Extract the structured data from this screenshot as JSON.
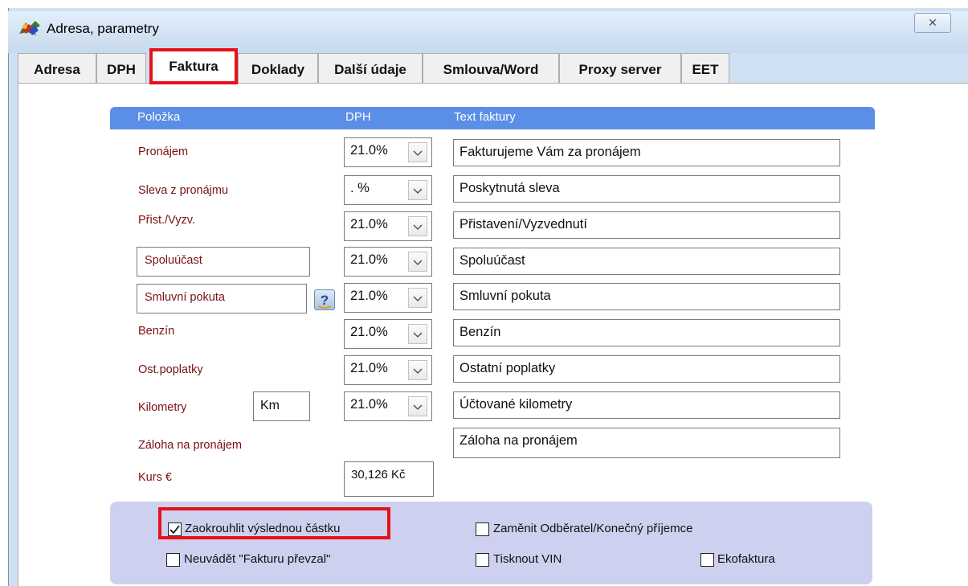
{
  "window": {
    "title": "Adresa, parametry",
    "close_glyph": "✕"
  },
  "tabs": [
    "Adresa",
    "DPH",
    "Faktura",
    "Doklady",
    "Další údaje",
    "Smlouva/Word",
    "Proxy server",
    "EET"
  ],
  "active_tab": "Faktura",
  "table_header": {
    "col_item": "Položka",
    "col_vat": "DPH",
    "col_text": "Text faktury"
  },
  "rows": [
    {
      "label": "Pronájem",
      "vat": "21.0%",
      "text": "Fakturujeme Vám za pronájem"
    },
    {
      "label": "Sleva z pronájmu",
      "vat": ". %",
      "text": "Poskytnutá sleva"
    },
    {
      "label": "Přist./Vyzv.",
      "vat": "21.0%",
      "text": "Přistavení/Vyzvednutí"
    },
    {
      "label": "Spoluúčast",
      "vat": "21.0%",
      "text": "Spoluúčast"
    },
    {
      "label": "Smluvní pokuta",
      "vat": "21.0%",
      "text": "Smluvní pokuta"
    },
    {
      "label": "Benzín",
      "vat": "21.0%",
      "text": "Benzín"
    },
    {
      "label": "Ost.poplatky",
      "vat": "21.0%",
      "text": "Ostatní poplatky"
    },
    {
      "label": "Kilometry",
      "unit": "Km",
      "vat": "21.0%",
      "text": "Účtované kilometry"
    },
    {
      "label": "Záloha na pronájem",
      "text": "Záloha na pronájem"
    }
  ],
  "exchange": {
    "label": "Kurs  €",
    "value": "30,126 Kč"
  },
  "checkboxes": {
    "round": {
      "label": "Zaokrouhlit  výslednou částku",
      "checked": true
    },
    "no_received": {
      "label": "Neuvádět \"Fakturu převzal\"",
      "checked": false
    },
    "swap": {
      "label": "Zaměnit Odběratel/Konečný příjemce",
      "checked": false
    },
    "vin": {
      "label": "Tisknout VIN",
      "checked": false
    },
    "eco": {
      "label": "Ekofaktura",
      "checked": false
    }
  },
  "colors": {
    "header_bar": "#5b8ee6",
    "label_text": "#7a1010",
    "highlight": "#e8101a",
    "bottom_area": "#cdd1ef"
  },
  "icons": {
    "app": "app-logo-icon",
    "help": "help-question-icon",
    "dropdown": "chevron-down-icon",
    "close": "close-icon"
  }
}
